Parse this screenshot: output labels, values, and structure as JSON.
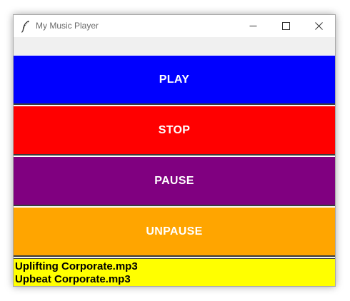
{
  "window": {
    "title": "My Music Player",
    "app_icon": "feather-icon",
    "controls": {
      "minimize_icon": "minimize-icon",
      "maximize_icon": "maximize-icon",
      "close_icon": "close-icon"
    }
  },
  "buttons": {
    "play": {
      "label": "PLAY",
      "color": "#0000ff"
    },
    "stop": {
      "label": "STOP",
      "color": "#ff0000"
    },
    "pause": {
      "label": "PAUSE",
      "color": "#800080"
    },
    "unpause": {
      "label": "UNPAUSE",
      "color": "#ffa500"
    }
  },
  "playlist": {
    "background": "#ffff00",
    "items": [
      "Uplifting Corporate.mp3",
      "Upbeat Corporate.mp3"
    ]
  }
}
